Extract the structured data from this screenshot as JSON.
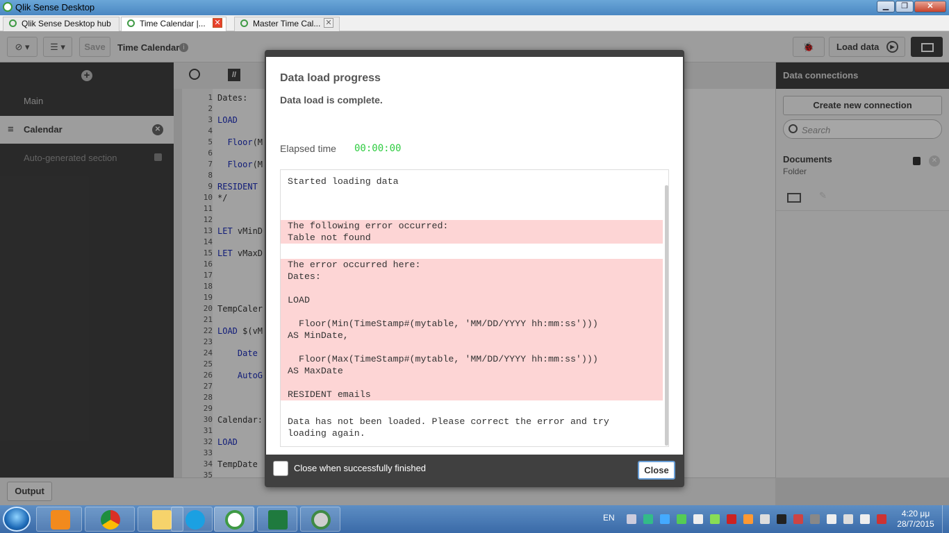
{
  "window": {
    "title": "Qlik Sense Desktop",
    "controls": [
      "minimize-icon",
      "maximize-icon",
      "close-icon"
    ]
  },
  "tabs": [
    {
      "label": "Qlik Sense Desktop hub",
      "active": false
    },
    {
      "label": "Time Calendar |...",
      "active": true
    },
    {
      "label": "Master Time Cal...",
      "active": false
    }
  ],
  "toolbar": {
    "save_label": "Save",
    "app_title": "Time Calendar",
    "load_data_label": "Load data"
  },
  "sections": [
    {
      "label": "Main"
    },
    {
      "label": "Calendar"
    },
    {
      "label": "Auto-generated section"
    }
  ],
  "editor": {
    "line_numbers": [
      "1",
      "2",
      "3",
      "4",
      "5",
      "6",
      "7",
      "8",
      "9",
      "10",
      "11",
      "12",
      "13",
      "14",
      "15",
      "16",
      "17",
      "18",
      "19",
      "20",
      "21",
      "22",
      "23",
      "24",
      "25",
      "26",
      "27",
      "28",
      "29",
      "30",
      "31",
      "32",
      "33",
      "34",
      "35"
    ],
    "lines": [
      {
        "n": 0,
        "text": "Dates:",
        "kw": false
      },
      {
        "n": 2,
        "text": "LOAD",
        "kw": true
      },
      {
        "n": 4,
        "text": "  Floor(M",
        "kw": true
      },
      {
        "n": 6,
        "text": "  Floor(M",
        "kw": true
      },
      {
        "n": 8,
        "text": "RESIDENT",
        "kw": true
      },
      {
        "n": 9,
        "text": "*/",
        "kw": false
      },
      {
        "n": 12,
        "text": "LET vMinD",
        "kw": true
      },
      {
        "n": 14,
        "text": "LET vMaxD",
        "kw": true
      },
      {
        "n": 19,
        "text": "TempCaler",
        "kw": false
      },
      {
        "n": 21,
        "text": "LOAD $(vM",
        "kw": true
      },
      {
        "n": 23,
        "text": "    Date",
        "kw": true
      },
      {
        "n": 25,
        "text": "    AutoG",
        "kw": true
      },
      {
        "n": 29,
        "text": "Calendar:",
        "kw": false
      },
      {
        "n": 31,
        "text": "LOAD",
        "kw": true
      },
      {
        "n": 33,
        "text": "TempDate",
        "kw": false
      }
    ]
  },
  "right_panel": {
    "header": "Data connections",
    "create_label": "Create new connection",
    "search_placeholder": "Search",
    "connection_name": "Documents",
    "connection_type": "Folder"
  },
  "output_label": "Output",
  "dialog": {
    "title": "Data load progress",
    "status": "Data load is complete.",
    "elapsed_label": "Elapsed time",
    "elapsed_value": "00:00:00",
    "log": {
      "started": "Started loading data",
      "error_block_1": "The following error occurred:\nTable not found",
      "error_block_2": "The error occurred here:\nDates:\n\nLOAD\n\n  Floor(Min(TimeStamp#(mytable, 'MM/DD/YYYY hh:mm:ss')))\nAS MinDate,\n\n  Floor(Max(TimeStamp#(mytable, 'MM/DD/YYYY hh:mm:ss')))\nAS MaxDate\n\nRESIDENT emails",
      "final": "Data has not been loaded. Please correct the error and try\nloading again."
    },
    "checkbox_label": "Close when successfully finished",
    "close_label": "Close"
  },
  "taskbar": {
    "apps": [
      "media-player-icon",
      "chrome-icon",
      "explorer-icon",
      "skype-icon",
      "qlik-sense-icon",
      "excel-icon",
      "qlikview-icon"
    ],
    "lang": "EN",
    "time": "4:20 μμ",
    "date": "28/7/2015"
  }
}
